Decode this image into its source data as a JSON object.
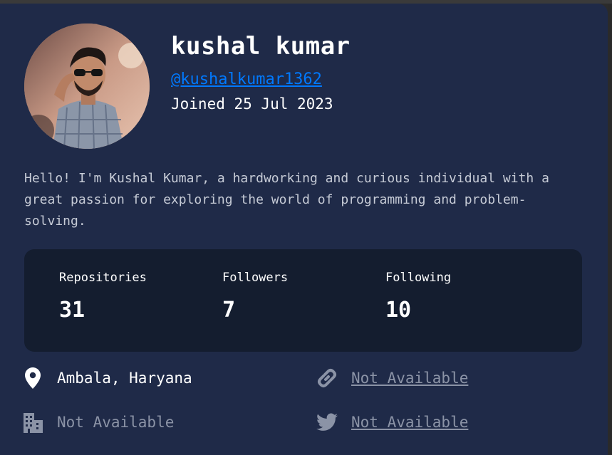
{
  "profile": {
    "name": "kushal kumar",
    "handle": "@kushalkumar1362",
    "joined": "Joined 25 Jul 2023",
    "bio": "Hello! I'm Kushal Kumar, a hardworking and curious individual with a great passion for exploring the world of programming and problem-solving."
  },
  "stats": [
    {
      "label": "Repositories",
      "value": "31"
    },
    {
      "label": "Followers",
      "value": "7"
    },
    {
      "label": "Following",
      "value": "10"
    }
  ],
  "info": {
    "location": "Ambala, Haryana",
    "website": "Not Available",
    "company": "Not Available",
    "twitter": "Not Available"
  },
  "colors": {
    "background": "#1f2a48",
    "stats_panel": "#141d2f",
    "accent": "#0079ff",
    "muted": "#8b93a6"
  },
  "icons": [
    "avatar-photo",
    "location-pin-icon",
    "link-icon",
    "building-icon",
    "twitter-icon"
  ]
}
